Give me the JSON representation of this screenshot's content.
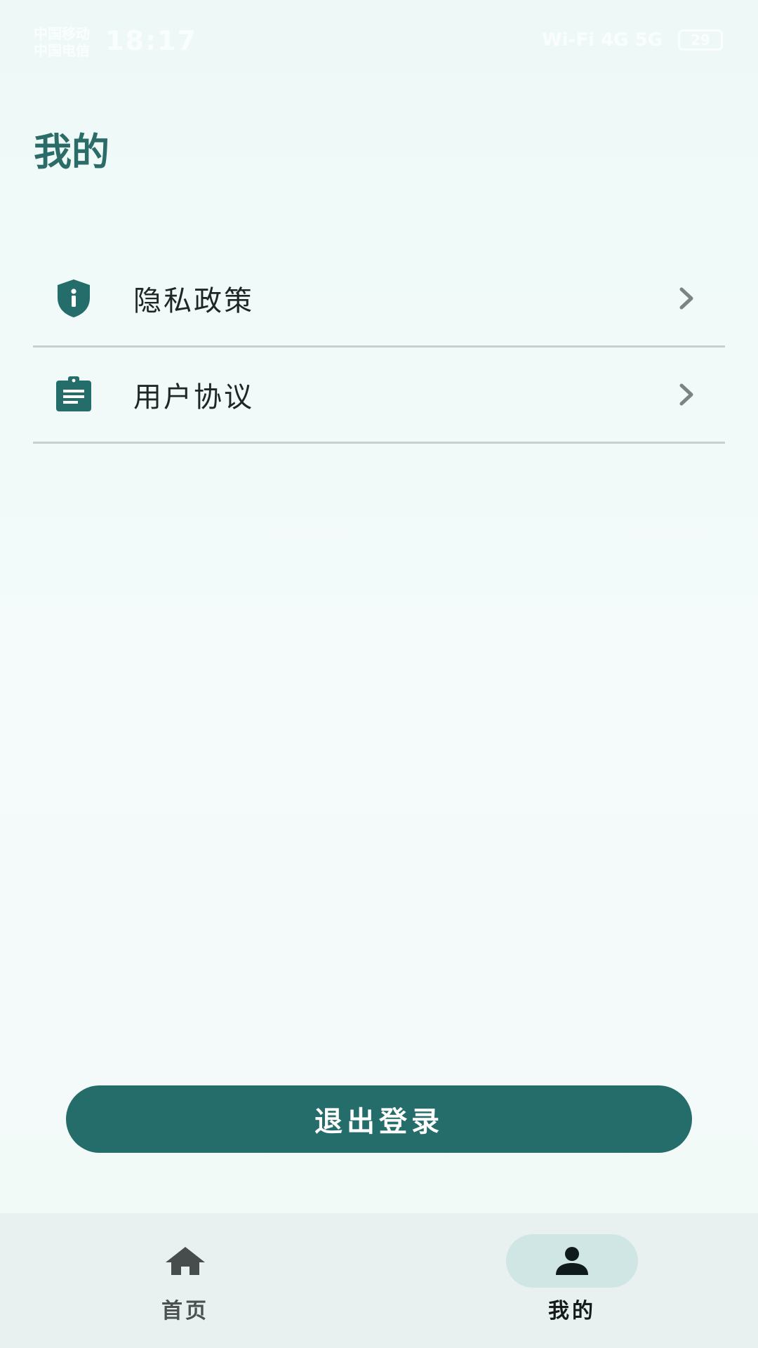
{
  "status_bar": {
    "carrier_line1": "中国移动",
    "carrier_line2": "中国电信",
    "time": "18:17",
    "indicators": "Wi-Fi 4G 5G",
    "battery": "29"
  },
  "header": {
    "title": "我的"
  },
  "menu": {
    "items": [
      {
        "label": "隐私政策",
        "icon": "shield-info-icon"
      },
      {
        "label": "用户协议",
        "icon": "clipboard-icon"
      }
    ]
  },
  "actions": {
    "logout_label": "退出登录"
  },
  "bottom_nav": {
    "items": [
      {
        "label": "首页",
        "icon": "home-icon",
        "active": false
      },
      {
        "label": "我的",
        "icon": "person-icon",
        "active": true
      }
    ]
  },
  "colors": {
    "accent": "#256d6a",
    "title": "#2b6c69",
    "background": "#f3fbfa",
    "nav_background": "#e8f1f0",
    "active_pill": "#cfe6e5",
    "divider": "#c7cfce"
  }
}
